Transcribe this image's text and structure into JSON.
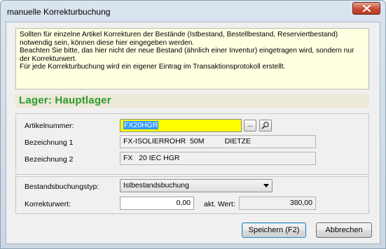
{
  "window": {
    "title": "manuelle Korrekturbuchung"
  },
  "info_lines": [
    "Sollten für einzelne Artikel Korrekturen der Bestände (Istbestand, Bestellbestand, Reserviertbestand)",
    "notwendig sein, können diese hier eingegeben werden.",
    "Beachten Sie bitte, das hier nicht der neue Bestand (ähnlich einer Inventur) eingetragen wird, sondern nur",
    "der Korrekturwert.",
    "Für jede Korrekturbuchung wird ein eigener Eintrag im Transaktionsprotokoll erstellt."
  ],
  "lager": {
    "title": "Lager: Hauptlager"
  },
  "article": {
    "label": "Artikelnummer:",
    "value": "FX20HGR",
    "browse_label": "...",
    "search_icon": "magnifier-icon",
    "field_color": "#ffff00"
  },
  "bezeichnung1": {
    "label": "Bezeichnung 1",
    "value": "FX-ISOLIERROHR  50M          DIETZE"
  },
  "bezeichnung2": {
    "label": "Bezeichnung 2",
    "value": "FX   20 IEC HGR"
  },
  "buchungstyp": {
    "label": "Bestandsbuchungstyp:",
    "value": "Istbestandsbuchung"
  },
  "korrektur": {
    "label": "Korrekturwert:",
    "value": "0,00"
  },
  "akt_wert": {
    "label": "akt. Wert:",
    "value": "380,00"
  },
  "buttons": {
    "save": "Speichern (F2)",
    "cancel": "Abbrechen"
  },
  "colors": {
    "lager_title": "#2c9a2c",
    "info_background": "#ffffe1",
    "selection": "#3399ff"
  }
}
